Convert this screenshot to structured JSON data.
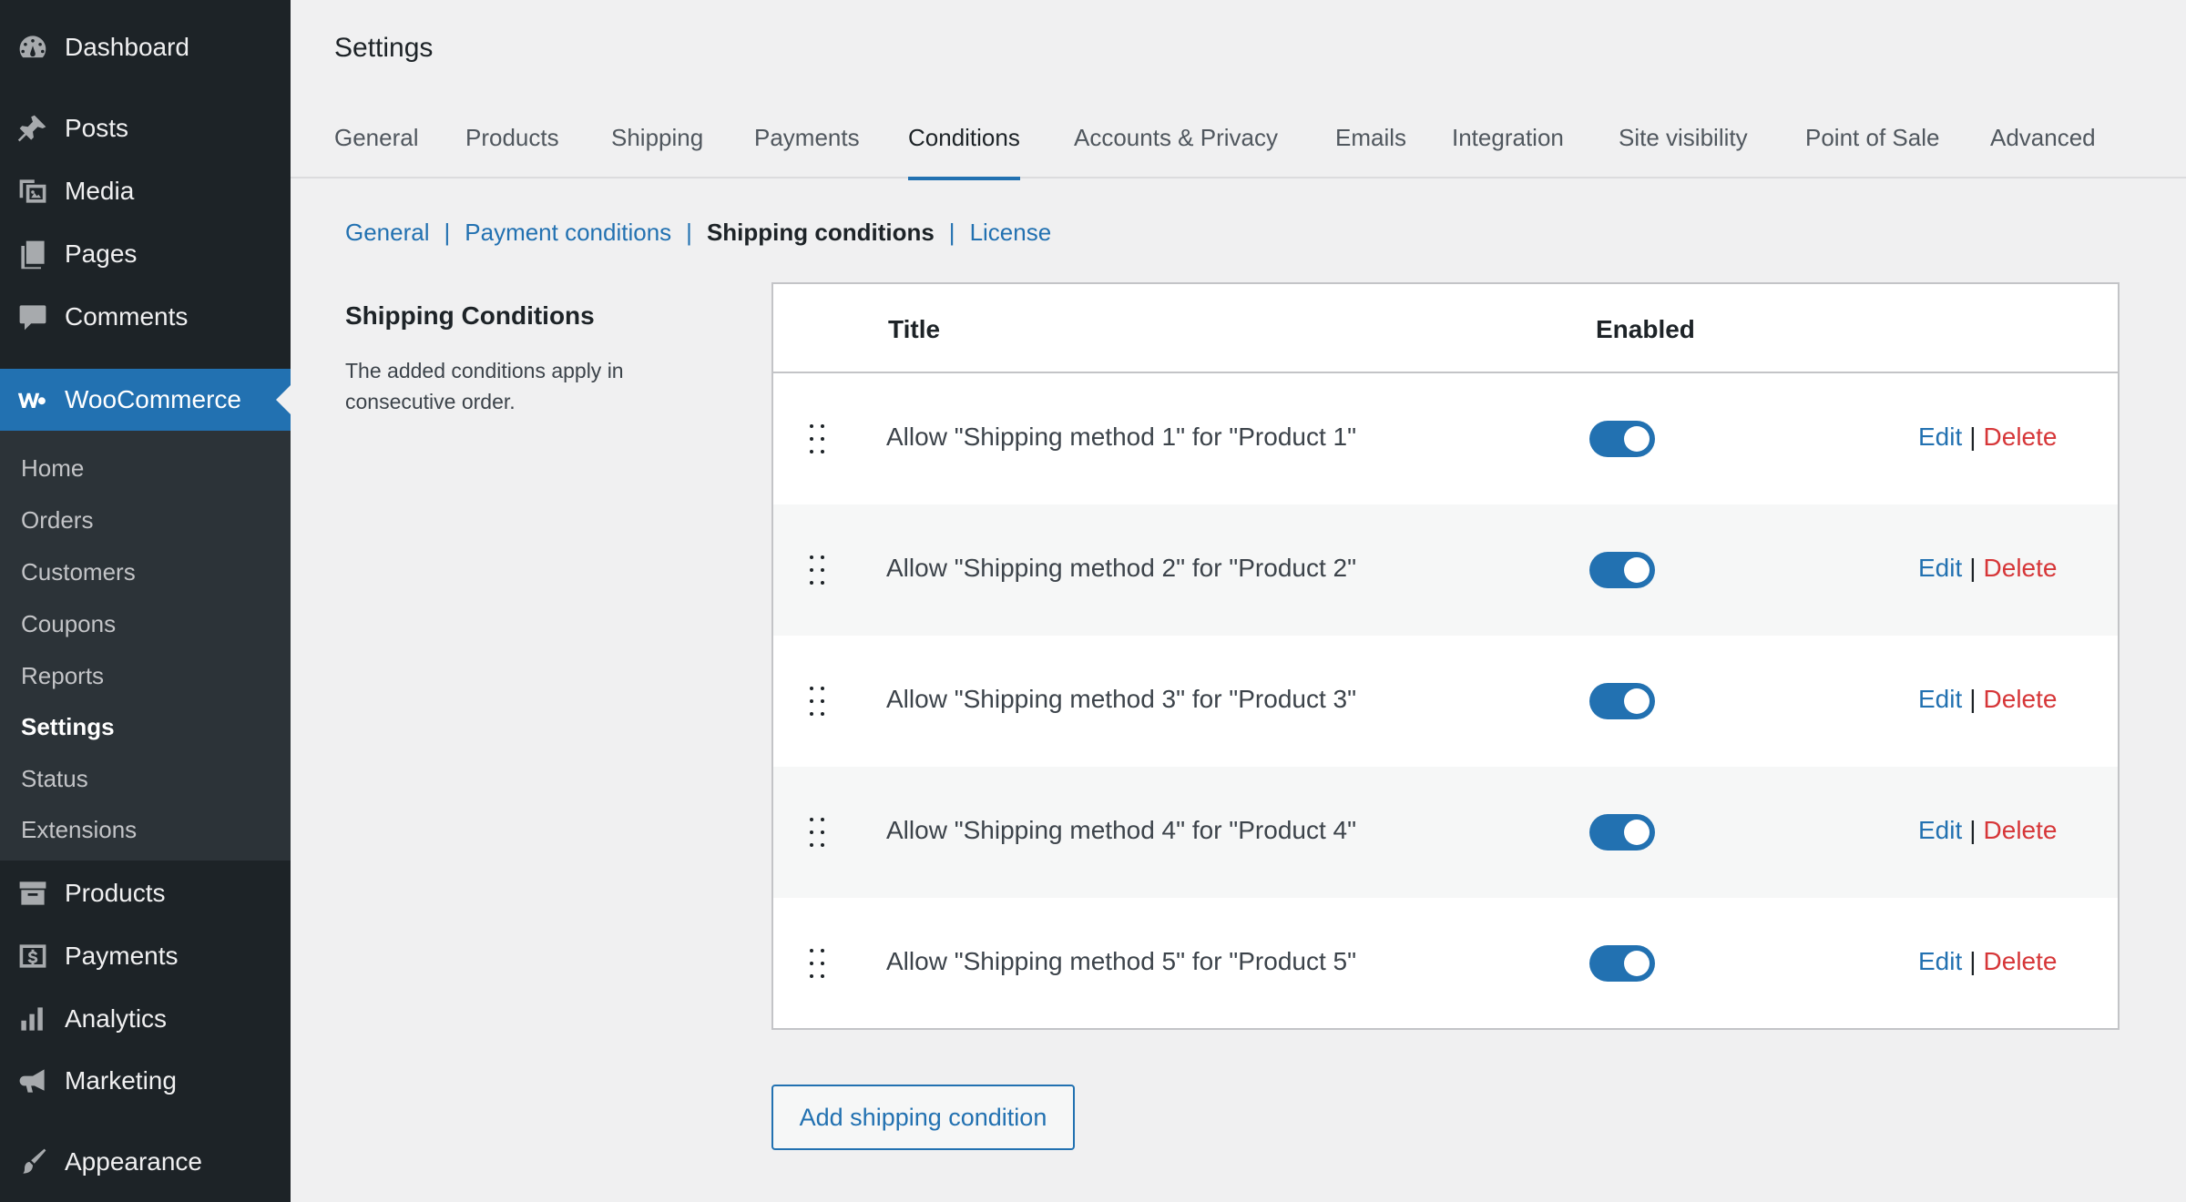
{
  "sidebar": {
    "items": [
      {
        "label": "Dashboard",
        "icon": "dashboard-icon"
      },
      {
        "label": "Posts",
        "icon": "pin-icon"
      },
      {
        "label": "Media",
        "icon": "media-icon"
      },
      {
        "label": "Pages",
        "icon": "pages-icon"
      },
      {
        "label": "Comments",
        "icon": "comment-icon"
      },
      {
        "label": "WooCommerce",
        "icon": "woocommerce-icon"
      },
      {
        "label": "Products",
        "icon": "archive-icon"
      },
      {
        "label": "Payments",
        "icon": "dollar-icon"
      },
      {
        "label": "Analytics",
        "icon": "bar-chart-icon"
      },
      {
        "label": "Marketing",
        "icon": "megaphone-icon"
      },
      {
        "label": "Appearance",
        "icon": "brush-icon"
      }
    ],
    "submenu": [
      "Home",
      "Orders",
      "Customers",
      "Coupons",
      "Reports",
      "Settings",
      "Status",
      "Extensions"
    ]
  },
  "header": {
    "title": "Settings"
  },
  "tabs": [
    "General",
    "Products",
    "Shipping",
    "Payments",
    "Conditions",
    "Accounts & Privacy",
    "Emails",
    "Integration",
    "Site visibility",
    "Point of Sale",
    "Advanced"
  ],
  "subnav": [
    "General",
    "Payment conditions",
    "Shipping conditions",
    "License"
  ],
  "section": {
    "title": "Shipping Conditions",
    "description": "The added conditions apply in consecutive order."
  },
  "table": {
    "headers": {
      "title": "Title",
      "enabled": "Enabled"
    },
    "rows": [
      {
        "title": "Allow \"Shipping method 1\" for \"Product 1\"",
        "enabled": true
      },
      {
        "title": "Allow \"Shipping method 2\" for \"Product 2\"",
        "enabled": true
      },
      {
        "title": "Allow \"Shipping method 3\" for \"Product 3\"",
        "enabled": true
      },
      {
        "title": "Allow \"Shipping method 4\" for \"Product 4\"",
        "enabled": true
      },
      {
        "title": "Allow \"Shipping method 5\" for \"Product 5\"",
        "enabled": true
      }
    ],
    "actions": {
      "edit": "Edit",
      "separator": "|",
      "delete": "Delete"
    }
  },
  "add_button": "Add shipping condition",
  "colors": {
    "accent": "#2271b1",
    "danger": "#d63638",
    "sidebar_bg": "#1d2327",
    "submenu_bg": "#2c3338"
  }
}
